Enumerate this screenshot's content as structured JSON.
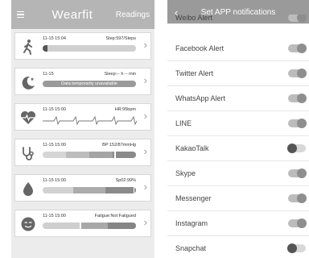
{
  "left": {
    "title": "Wearfit",
    "readings_label": "Readings",
    "cards": [
      {
        "time": "11-15 15:04",
        "value": "Step:597/Steps",
        "progress": 0.05
      },
      {
        "time": "11-15",
        "value": "Sleep:-- h -- min",
        "bar_text": "Data temporarily unavailable"
      },
      {
        "time": "11-15 15:00",
        "value": "HR:95bpm"
      },
      {
        "time": "11-15 15:00",
        "value": "BP:152/87mmHg",
        "marker": 0.77
      },
      {
        "time": "11-15 15:00",
        "value": "Sp02:99%",
        "marker": 0.97
      },
      {
        "time": "11-15 15:00",
        "value": "Fatigue:Not Fatigued",
        "marker": 0.4
      }
    ]
  },
  "right": {
    "title": "Set APP notifications",
    "partial_item": "Weibo Alert",
    "items": [
      {
        "label": "Facebook Alert",
        "on": true
      },
      {
        "label": "Twitter Alert",
        "on": true
      },
      {
        "label": "WhatsApp Alert",
        "on": true
      },
      {
        "label": "LINE",
        "on": true
      },
      {
        "label": "KakaoTalk",
        "on": false
      },
      {
        "label": "Skype",
        "on": true
      },
      {
        "label": "Messenger",
        "on": true
      },
      {
        "label": "Instagram",
        "on": true
      },
      {
        "label": "Snapchat",
        "on": false
      }
    ]
  }
}
